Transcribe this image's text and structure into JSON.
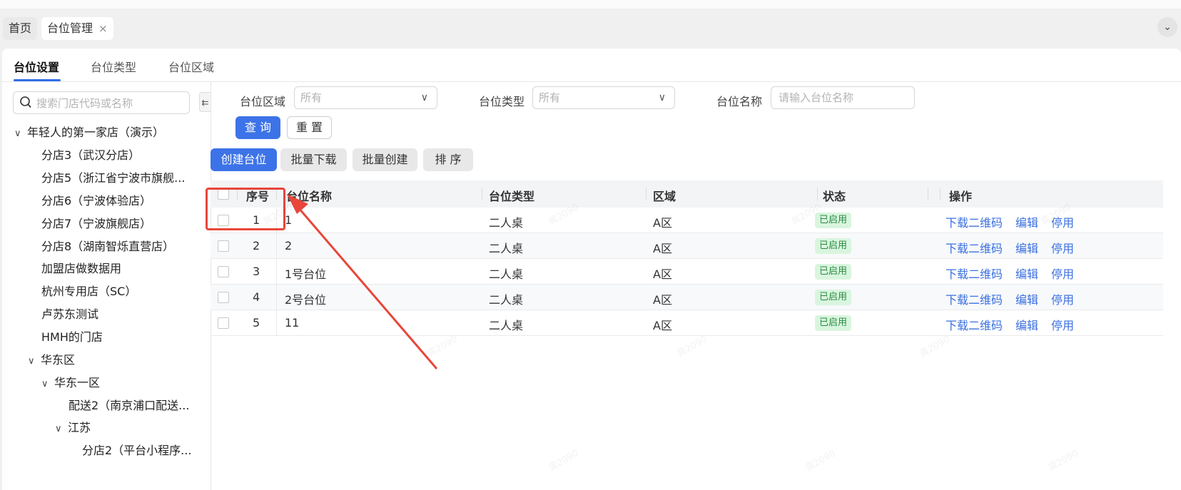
{
  "page_tabs": [
    {
      "label": "首页"
    },
    {
      "label": "台位管理",
      "close": "×"
    }
  ],
  "collapse_icon": "chevron-down",
  "sub_tabs": [
    {
      "label": "台位设置",
      "active": true
    },
    {
      "label": "台位类型"
    },
    {
      "label": "台位区域"
    }
  ],
  "sidebar": {
    "search_placeholder": "搜索门店代码或名称",
    "fold_symbol": "⇇",
    "tree": [
      {
        "label": "年轻人的第一家店（演示）",
        "expanded": true
      },
      {
        "label": "分店3（武汉分店）"
      },
      {
        "label": "分店5（浙江省宁波市旗舰..."
      },
      {
        "label": "分店6（宁波体验店）"
      },
      {
        "label": "分店7（宁波旗舰店）"
      },
      {
        "label": "分店8（湖南智烁直营店）"
      },
      {
        "label": "加盟店做数据用"
      },
      {
        "label": "杭州专用店（SC）"
      },
      {
        "label": "卢苏东测试"
      },
      {
        "label": "HMH的门店"
      },
      {
        "label": "华东区",
        "expanded": true
      },
      {
        "label": "华东一区",
        "expanded": true
      },
      {
        "label": "配送2（南京浦口配送..."
      },
      {
        "label": "江苏",
        "expanded": true
      },
      {
        "label": "分店2（平台小程序..."
      }
    ]
  },
  "filters": {
    "area_label": "台位区域",
    "area_value": "所有",
    "type_label": "台位类型",
    "type_value": "所有",
    "name_label": "台位名称",
    "name_placeholder": "请输入台位名称",
    "query_button": "查 询",
    "reset_button": "重 置"
  },
  "actions": {
    "create": "创建台位",
    "batch_download": "批量下载",
    "batch_create": "批量创建",
    "sort": "排 序"
  },
  "table": {
    "columns": [
      "序号",
      "台位名称",
      "台位类型",
      "区域",
      "状态",
      "操作"
    ],
    "rows": [
      {
        "index": "1",
        "name": "1",
        "type": "二人桌",
        "area": "A区",
        "status": "已启用"
      },
      {
        "index": "2",
        "name": "2",
        "type": "二人桌",
        "area": "A区",
        "status": "已启用"
      },
      {
        "index": "3",
        "name": "1号台位",
        "type": "二人桌",
        "area": "A区",
        "status": "已启用"
      },
      {
        "index": "4",
        "name": "2号台位",
        "type": "二人桌",
        "area": "A区",
        "status": "已启用"
      },
      {
        "index": "5",
        "name": "11",
        "type": "二人桌",
        "area": "A区",
        "status": "已启用"
      }
    ],
    "row_actions": [
      "下载二维码",
      "编辑",
      "停用"
    ]
  },
  "watermark": "龚2090",
  "colors": {
    "primary": "#3d73e8",
    "link": "#3a6fe0",
    "status_bg": "#d9f5df",
    "status_text": "#2a8a3f",
    "annotation": "#e8463b"
  }
}
